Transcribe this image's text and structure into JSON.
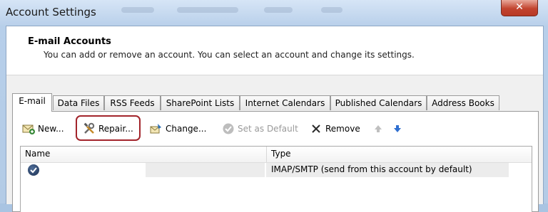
{
  "window": {
    "title": "Account Settings",
    "close_glyph": "✕"
  },
  "header": {
    "title": "E-mail Accounts",
    "description": "You can add or remove an account. You can select an account and change its settings."
  },
  "tabs": [
    {
      "label": "E-mail",
      "active": true
    },
    {
      "label": "Data Files",
      "active": false
    },
    {
      "label": "RSS Feeds",
      "active": false
    },
    {
      "label": "SharePoint Lists",
      "active": false
    },
    {
      "label": "Internet Calendars",
      "active": false
    },
    {
      "label": "Published Calendars",
      "active": false
    },
    {
      "label": "Address Books",
      "active": false
    }
  ],
  "toolbar": {
    "new_label": "New...",
    "repair_label": "Repair...",
    "change_label": "Change...",
    "set_default_label": "Set as Default",
    "remove_label": "Remove",
    "icons": [
      "new-account-icon",
      "repair-tools-icon",
      "change-account-icon",
      "set-default-check-icon",
      "remove-x-icon",
      "move-up-arrow-icon",
      "move-down-arrow-icon"
    ],
    "accent_color": "#a2242b"
  },
  "accounts_list": {
    "columns": [
      "Name",
      "Type"
    ],
    "rows": [
      {
        "name": "",
        "type": "IMAP/SMTP (send from this account by default)",
        "is_default": true
      }
    ]
  }
}
